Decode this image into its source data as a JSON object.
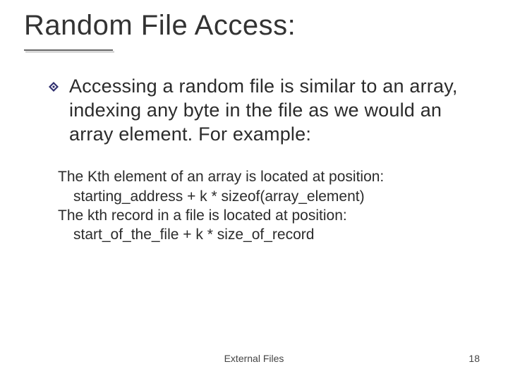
{
  "title": "Random File Access:",
  "bullet": "Accessing a random file is similar to an array, indexing any byte in the file as we would an array element. For example:",
  "detail": {
    "line1": "The Kth element of an array is located at position:",
    "line2": "starting_address + k * sizeof(array_element)",
    "line3": "The kth record in a file is located at position:",
    "line4": "start_of_the_file + k * size_of_record"
  },
  "footer_center": "External Files",
  "footer_right": "18"
}
